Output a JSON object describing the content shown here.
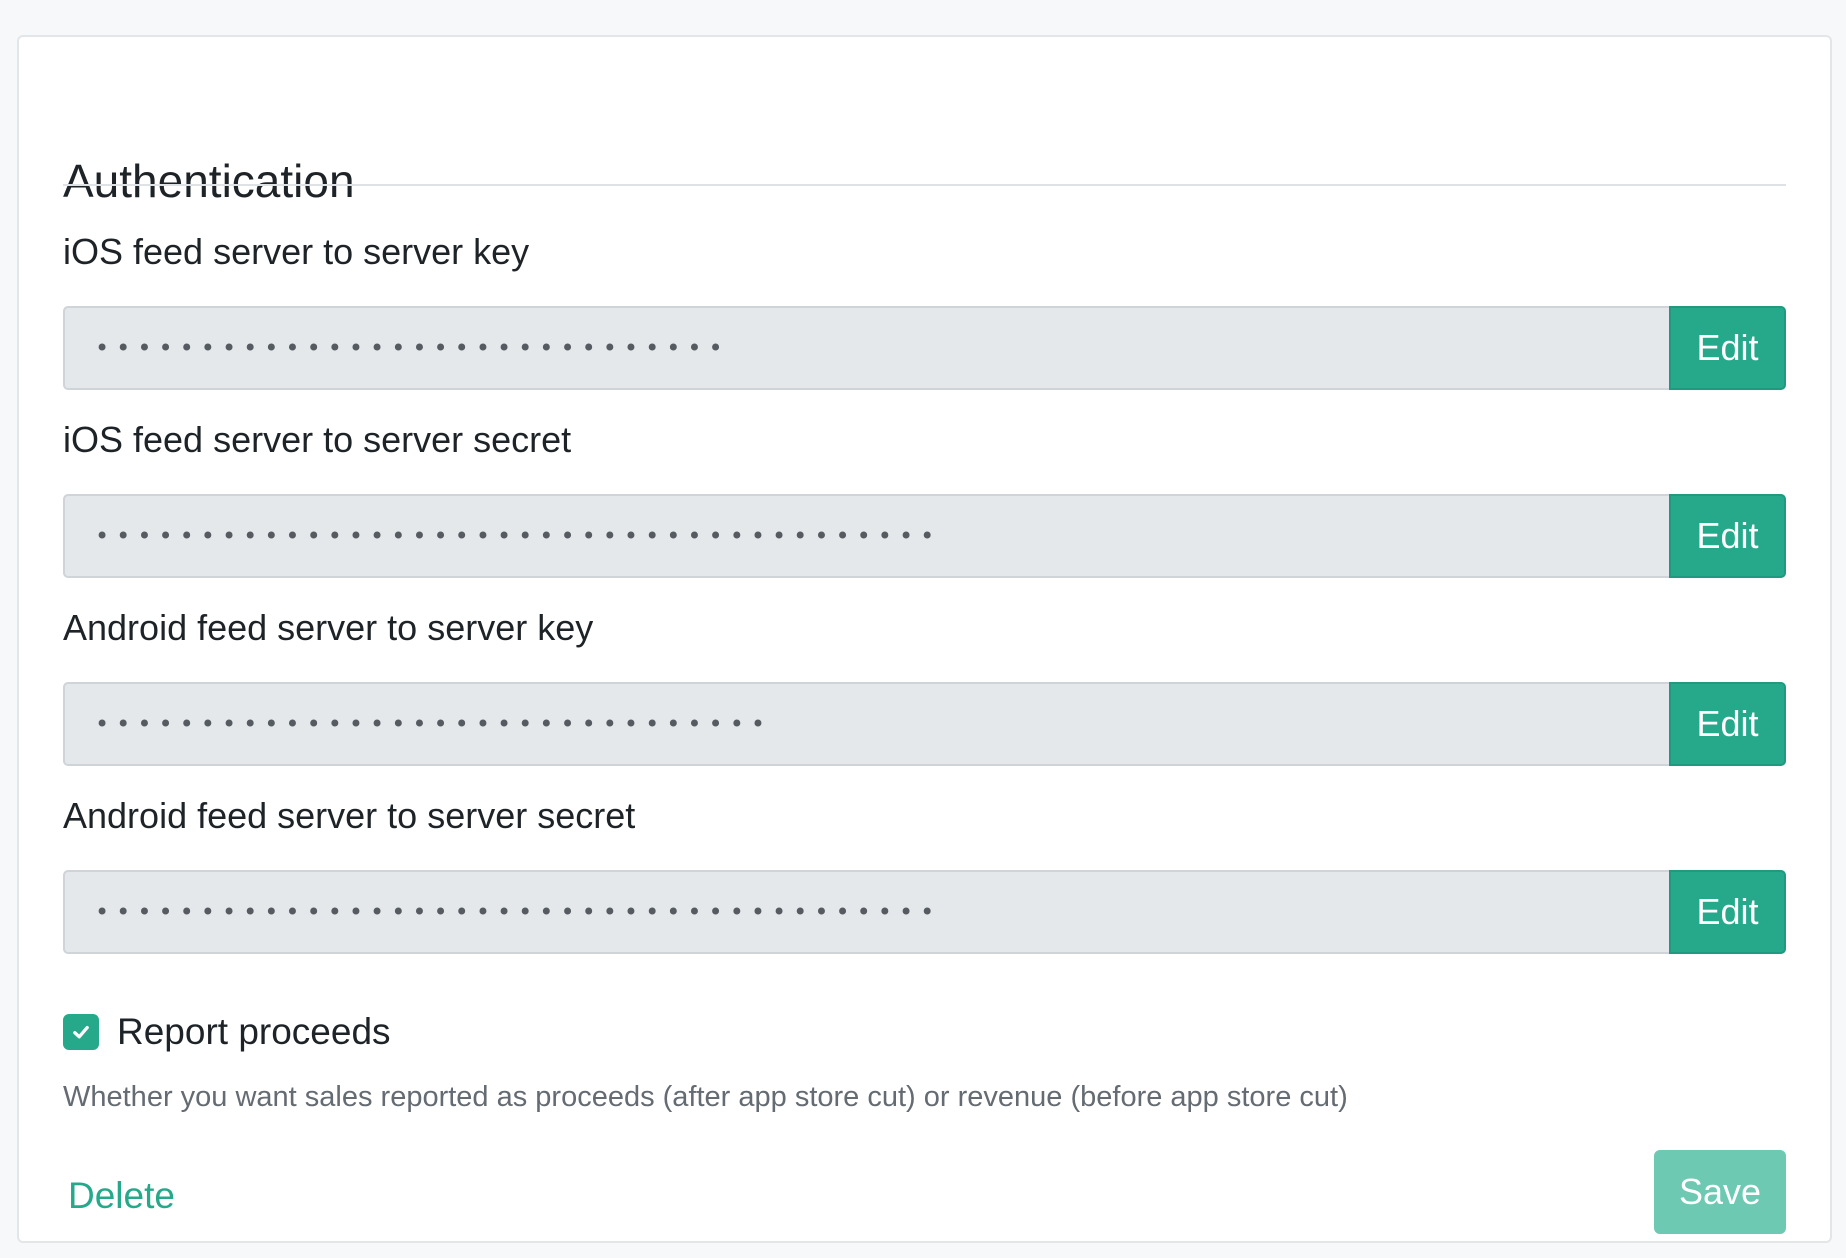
{
  "section": {
    "title": "Authentication"
  },
  "fields": [
    {
      "label": "iOS feed server to server key",
      "masked_value": "••••••••••••••••••••••••••••••",
      "edit_label": "Edit"
    },
    {
      "label": "iOS feed server to server secret",
      "masked_value": "••••••••••••••••••••••••••••••••••••••••",
      "edit_label": "Edit"
    },
    {
      "label": "Android feed server to server key",
      "masked_value": "••••••••••••••••••••••••••••••••",
      "edit_label": "Edit"
    },
    {
      "label": "Android feed server to server secret",
      "masked_value": "••••••••••••••••••••••••••••••••••••••••",
      "edit_label": "Edit"
    }
  ],
  "report_proceeds": {
    "checked": true,
    "label": "Report proceeds",
    "help_text": "Whether you want sales reported as proceeds (after app store cut) or revenue (before app store cut)"
  },
  "actions": {
    "delete_label": "Delete",
    "save_label": "Save"
  },
  "colors": {
    "accent": "#26a98b",
    "save_disabled": "#6dc9b2",
    "input_bg": "#e4e8eb",
    "help_text": "#646b72"
  },
  "icons": {
    "checkbox": "check-icon"
  }
}
